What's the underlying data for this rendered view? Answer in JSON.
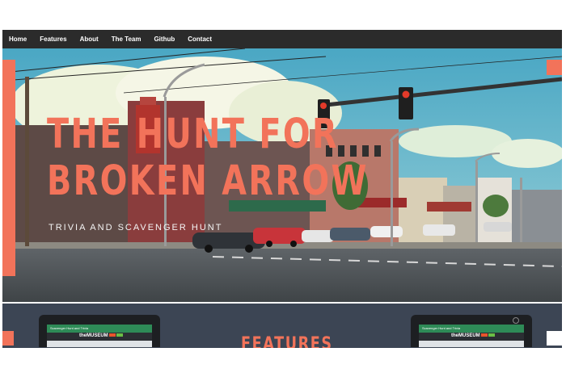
{
  "nav": {
    "items": [
      {
        "label": "Home"
      },
      {
        "label": "Features"
      },
      {
        "label": "About"
      },
      {
        "label": "The Team"
      },
      {
        "label": "Github"
      },
      {
        "label": "Contact"
      }
    ]
  },
  "hero": {
    "title_line1": "THE HUNT FOR",
    "title_line2": "BROKEN ARROW",
    "subtitle": "TRIVIA AND SCAVENGER HUNT",
    "background_image": "street-scene-photo",
    "accent_color": "#f2735a"
  },
  "features": {
    "title": "FEATURES",
    "tablet_left": {
      "header": "Scavenger Hunt and Trivia",
      "logo_prefix": "the",
      "logo_text": "MUSEUM"
    },
    "tablet_right": {
      "header": "Scavenger Hunt and Trivia",
      "logo_prefix": "the",
      "logo_text": "MUSEUM"
    }
  }
}
